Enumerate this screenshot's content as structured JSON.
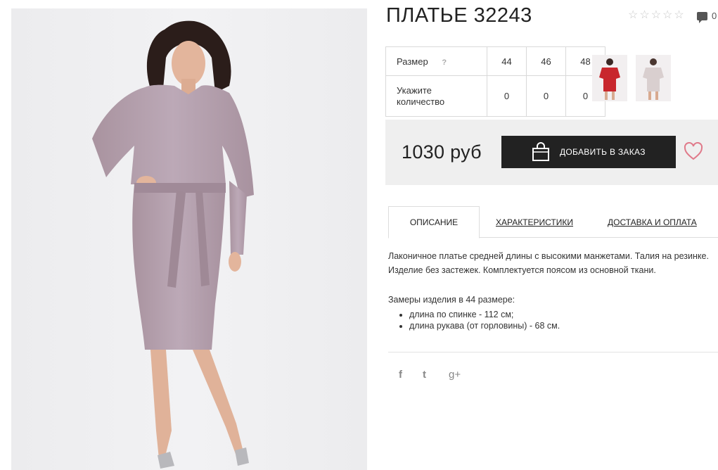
{
  "product": {
    "title": "ПЛАТЬЕ 32243",
    "rating_stars": 0,
    "rating_max": 5,
    "comments_count": "0"
  },
  "sizes": {
    "size_label": "Размер",
    "qty_label": "Укажите количество",
    "help": "?",
    "columns": [
      "44",
      "46",
      "48"
    ],
    "quantities": [
      "0",
      "0",
      "0"
    ]
  },
  "thumbnails": [
    {
      "color_name": "red",
      "color": "#c8272d"
    },
    {
      "color_name": "beige",
      "color": "#d9cfcf"
    }
  ],
  "purchase": {
    "price": "1030 руб",
    "add_button": "ДОБАВИТЬ В ЗАКАЗ"
  },
  "tabs": [
    "ОПИСАНИЕ",
    "ХАРАКТЕРИСТИКИ",
    "ДОСТАВКА И ОПЛАТА"
  ],
  "description": {
    "text": "Лаконичное платье средней длины с высокими манжетами. Талия на резинке. Изделие без застежек. Комплектуется поясом из основной ткани.",
    "measures_heading": "Замеры изделия в 44 размере:",
    "measures": [
      "длина по спинке - 112 см;",
      "длина рукава (от горловины) - 68 см."
    ]
  },
  "social": [
    "f",
    "t",
    "g+"
  ],
  "colors": {
    "dress": "#b7a3b2",
    "button": "#222222",
    "price_bg": "#efefef",
    "heart": "#e07a8a"
  }
}
